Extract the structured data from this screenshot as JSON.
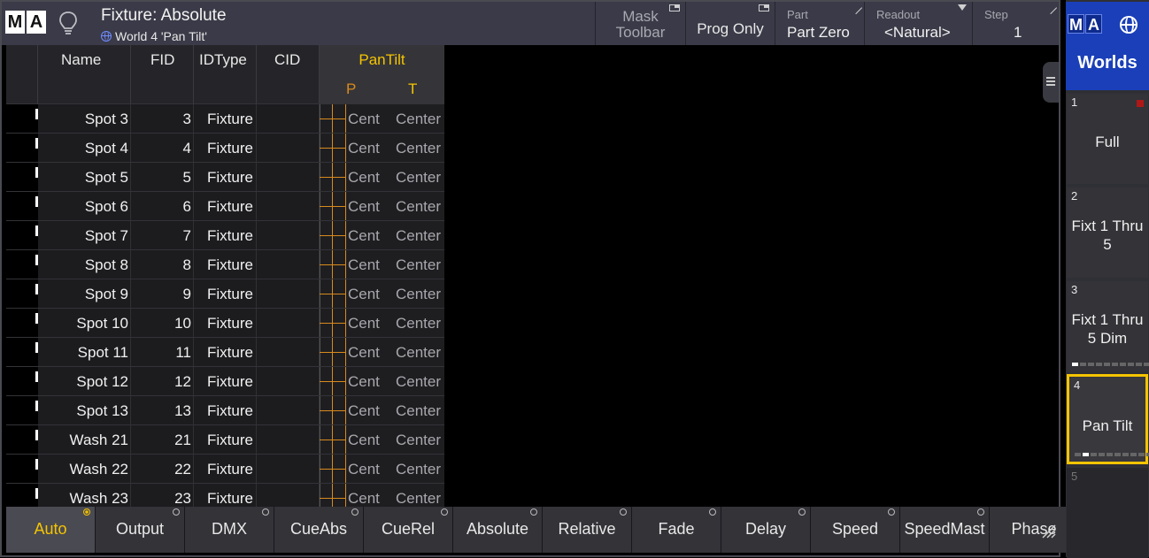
{
  "window": {
    "logo_letters": [
      "M",
      "A"
    ],
    "title": "Fixture: Absolute",
    "subtitle": "World 4 'Pan Tilt'"
  },
  "toolbar": {
    "mask_toolbar": [
      "Mask",
      "Toolbar"
    ],
    "prog_only": "Prog Only",
    "part_label": "Part",
    "part_value": "Part Zero",
    "readout_label": "Readout",
    "readout_value": "<Natural>",
    "step_label": "Step",
    "step_value": "1"
  },
  "grid": {
    "columns": {
      "name": "Name",
      "fid": "FID",
      "idtype": "IDType",
      "cid": "CID"
    },
    "pantilt": {
      "title": "PanTilt",
      "pan": "P",
      "tilt": "T"
    },
    "rows": [
      {
        "name": "Spot 3",
        "fid": "3",
        "idtype": "Fixture",
        "cid": "",
        "pan": "Cent",
        "tilt": "Center"
      },
      {
        "name": "Spot 4",
        "fid": "4",
        "idtype": "Fixture",
        "cid": "",
        "pan": "Cent",
        "tilt": "Center"
      },
      {
        "name": "Spot 5",
        "fid": "5",
        "idtype": "Fixture",
        "cid": "",
        "pan": "Cent",
        "tilt": "Center"
      },
      {
        "name": "Spot 6",
        "fid": "6",
        "idtype": "Fixture",
        "cid": "",
        "pan": "Cent",
        "tilt": "Center"
      },
      {
        "name": "Spot 7",
        "fid": "7",
        "idtype": "Fixture",
        "cid": "",
        "pan": "Cent",
        "tilt": "Center"
      },
      {
        "name": "Spot 8",
        "fid": "8",
        "idtype": "Fixture",
        "cid": "",
        "pan": "Cent",
        "tilt": "Center"
      },
      {
        "name": "Spot 9",
        "fid": "9",
        "idtype": "Fixture",
        "cid": "",
        "pan": "Cent",
        "tilt": "Center"
      },
      {
        "name": "Spot 10",
        "fid": "10",
        "idtype": "Fixture",
        "cid": "",
        "pan": "Cent",
        "tilt": "Center"
      },
      {
        "name": "Spot 11",
        "fid": "11",
        "idtype": "Fixture",
        "cid": "",
        "pan": "Cent",
        "tilt": "Center"
      },
      {
        "name": "Spot 12",
        "fid": "12",
        "idtype": "Fixture",
        "cid": "",
        "pan": "Cent",
        "tilt": "Center"
      },
      {
        "name": "Spot 13",
        "fid": "13",
        "idtype": "Fixture",
        "cid": "",
        "pan": "Cent",
        "tilt": "Center"
      },
      {
        "name": "Wash 21",
        "fid": "21",
        "idtype": "Fixture",
        "cid": "",
        "pan": "Cent",
        "tilt": "Center"
      },
      {
        "name": "Wash 22",
        "fid": "22",
        "idtype": "Fixture",
        "cid": "",
        "pan": "Cent",
        "tilt": "Center"
      },
      {
        "name": "Wash 23",
        "fid": "23",
        "idtype": "Fixture",
        "cid": "",
        "pan": "Cent",
        "tilt": "Center"
      }
    ]
  },
  "bottom_bar": {
    "active": "Auto",
    "buttons": [
      "Auto",
      "Output",
      "DMX",
      "CueAbs",
      "CueRel",
      "Absolute",
      "Relative",
      "Fade",
      "Delay",
      "Speed",
      "SpeedMast",
      "Phase"
    ]
  },
  "worlds_panel": {
    "title": "Worlds",
    "pool": [
      {
        "num": "1",
        "lines": [
          "Full"
        ]
      },
      {
        "num": "2",
        "lines": [
          "Fixt 1 Thru",
          "5"
        ]
      },
      {
        "num": "3",
        "lines": [
          "Fixt 1 Thru",
          "5 Dim"
        ]
      },
      {
        "num": "4",
        "lines": [
          "Pan Tilt"
        ]
      },
      {
        "num": "5",
        "lines": []
      }
    ],
    "selected": "4"
  },
  "colors": {
    "accent_yellow": "#f5c400",
    "pan_orange": "#d98a1c",
    "worlds_blue": "#1a3fb8",
    "title_bar": "#3a3a48"
  }
}
